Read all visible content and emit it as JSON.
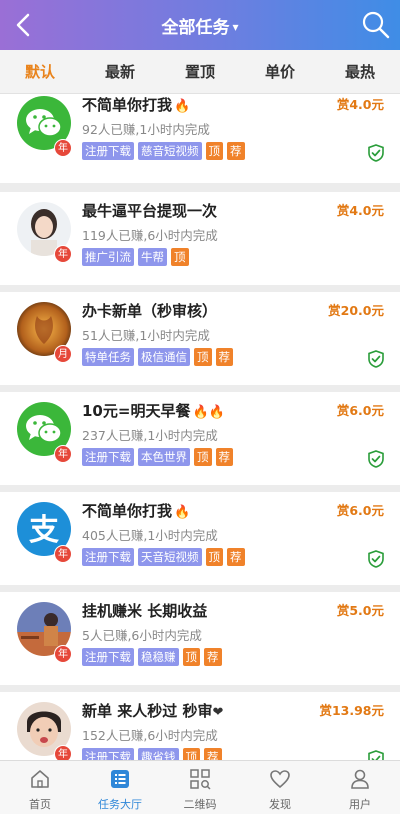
{
  "header": {
    "title": "全部任务",
    "title_caret": "▾"
  },
  "tabs": [
    "默认",
    "最新",
    "置顶",
    "单价",
    "最热"
  ],
  "tasks": [
    {
      "avatar": "wechat-logo",
      "badge": "年",
      "title": "不简单你打我",
      "fire": "🔥",
      "stats": "92人已赚,1小时内完成",
      "tags": [
        {
          "text": "注册下载",
          "style": "blue"
        },
        {
          "text": "慈音短视频",
          "style": "blue"
        },
        {
          "text": "顶",
          "style": "orange"
        },
        {
          "text": "荐",
          "style": "orange"
        }
      ],
      "reward": "赏4.0元",
      "verified": true
    },
    {
      "avatar": "girl-photo",
      "badge": "年",
      "title": "最牛逼平台提现一次",
      "fire": "",
      "stats": "119人已赚,6小时内完成",
      "tags": [
        {
          "text": "推广引流",
          "style": "blue"
        },
        {
          "text": "牛帮",
          "style": "blue"
        },
        {
          "text": "顶",
          "style": "orange"
        }
      ],
      "reward": "赏4.0元",
      "verified": false
    },
    {
      "avatar": "orange-photo",
      "badge": "月",
      "title": "办卡新单（秒审核）",
      "fire": "",
      "stats": "51人已赚,1小时内完成",
      "tags": [
        {
          "text": "特单任务",
          "style": "blue"
        },
        {
          "text": "极信通信",
          "style": "blue"
        },
        {
          "text": "顶",
          "style": "orange"
        },
        {
          "text": "荐",
          "style": "orange"
        }
      ],
      "reward": "赏20.0元",
      "verified": true
    },
    {
      "avatar": "wechat-logo",
      "badge": "年",
      "title": "10元=明天早餐",
      "fire": "🔥🔥",
      "stats": "237人已赚,1小时内完成",
      "tags": [
        {
          "text": "注册下载",
          "style": "blue"
        },
        {
          "text": "本色世界",
          "style": "blue"
        },
        {
          "text": "顶",
          "style": "orange"
        },
        {
          "text": "荐",
          "style": "orange"
        }
      ],
      "reward": "赏6.0元",
      "verified": true
    },
    {
      "avatar": "alipay-logo",
      "badge": "年",
      "title": "不简单你打我",
      "fire": "🔥",
      "stats": "405人已赚,1小时内完成",
      "tags": [
        {
          "text": "注册下载",
          "style": "blue"
        },
        {
          "text": "天音短视频",
          "style": "blue"
        },
        {
          "text": "顶",
          "style": "orange"
        },
        {
          "text": "荐",
          "style": "orange"
        }
      ],
      "reward": "赏6.0元",
      "verified": true
    },
    {
      "avatar": "sunset-photo",
      "badge": "年",
      "title": "挂机赚米 长期收益",
      "fire": "",
      "stats": "5人已赚,6小时内完成",
      "tags": [
        {
          "text": "注册下载",
          "style": "blue"
        },
        {
          "text": "稳稳赚",
          "style": "blue"
        },
        {
          "text": "顶",
          "style": "orange"
        },
        {
          "text": "荐",
          "style": "orange"
        }
      ],
      "reward": "赏5.0元",
      "verified": false
    },
    {
      "avatar": "kid-photo",
      "badge": "年",
      "title": "新单 来人秒过 秒审",
      "heart": "❤",
      "fire": "",
      "stats": "152人已赚,6小时内完成",
      "tags": [
        {
          "text": "注册下载",
          "style": "blue"
        },
        {
          "text": "趣省钱",
          "style": "blue"
        },
        {
          "text": "顶",
          "style": "orange"
        },
        {
          "text": "荐",
          "style": "orange"
        }
      ],
      "reward": "赏13.98元",
      "verified": true
    }
  ],
  "tabbar": [
    {
      "label": "首页",
      "icon": "home-icon",
      "active": false
    },
    {
      "label": "任务大厅",
      "icon": "list-icon",
      "active": true
    },
    {
      "label": "二维码",
      "icon": "qrcode-icon",
      "active": false
    },
    {
      "label": "发现",
      "icon": "heart-icon",
      "active": false
    },
    {
      "label": "用户",
      "icon": "user-icon",
      "active": false
    }
  ],
  "colors": {
    "accent": "#e9831b",
    "tab_active": "#2f87d8",
    "tag_blue": "#8e96ec",
    "tag_orange": "#f0822a",
    "verified": "#2a9d3a"
  }
}
